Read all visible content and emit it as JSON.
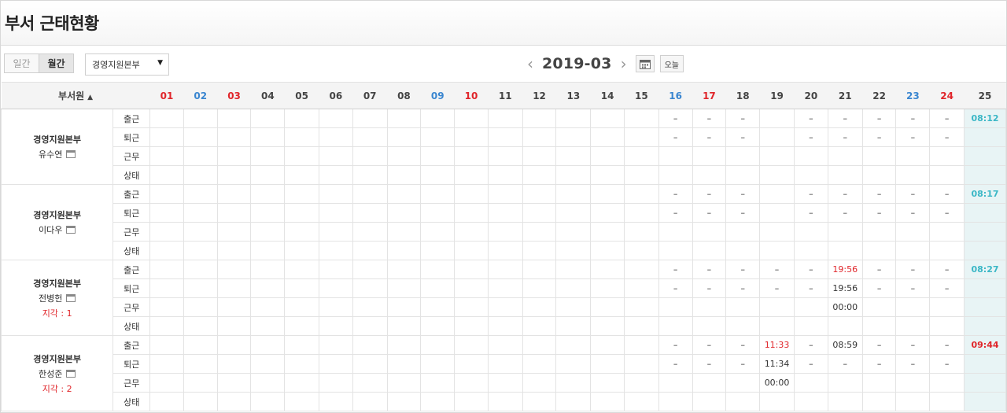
{
  "page": {
    "title": "부서 근태현황"
  },
  "toolbar": {
    "view_tabs": [
      {
        "label": "일간",
        "active": false
      },
      {
        "label": "월간",
        "active": true
      }
    ],
    "dept_select": {
      "value": "경영지원본부",
      "arrow": "▼"
    },
    "month": {
      "label": "2019-03",
      "prev_icon": "‹",
      "next_icon": "›"
    },
    "calendar_icon": "calendar-icon",
    "today_label": "오늘"
  },
  "colors": {
    "weekend_red": "#e0262b",
    "saturday_blue": "#3a86d0",
    "today_cyan": "#3bb7c6",
    "today_bg": "#e8f4f5",
    "late_red": "#e0262b"
  },
  "table": {
    "member_header": "부서원",
    "sort_icon": "▲",
    "days": [
      {
        "label": "01",
        "type": "sun"
      },
      {
        "label": "02",
        "type": "sat"
      },
      {
        "label": "03",
        "type": "sun"
      },
      {
        "label": "04",
        "type": "weekday"
      },
      {
        "label": "05",
        "type": "weekday"
      },
      {
        "label": "06",
        "type": "weekday"
      },
      {
        "label": "07",
        "type": "weekday"
      },
      {
        "label": "08",
        "type": "weekday"
      },
      {
        "label": "09",
        "type": "sat"
      },
      {
        "label": "10",
        "type": "sun"
      },
      {
        "label": "11",
        "type": "weekday"
      },
      {
        "label": "12",
        "type": "weekday"
      },
      {
        "label": "13",
        "type": "weekday"
      },
      {
        "label": "14",
        "type": "weekday"
      },
      {
        "label": "15",
        "type": "weekday"
      },
      {
        "label": "16",
        "type": "sat"
      },
      {
        "label": "17",
        "type": "sun"
      },
      {
        "label": "18",
        "type": "weekday"
      },
      {
        "label": "19",
        "type": "weekday"
      },
      {
        "label": "20",
        "type": "weekday"
      },
      {
        "label": "21",
        "type": "weekday"
      },
      {
        "label": "22",
        "type": "weekday"
      },
      {
        "label": "23",
        "type": "sat"
      },
      {
        "label": "24",
        "type": "sun"
      },
      {
        "label": "25",
        "type": "today"
      }
    ],
    "row_types": [
      "출근",
      "퇴근",
      "근무",
      "상태"
    ],
    "members": [
      {
        "dept": "경영지원본부",
        "name": "유수연",
        "late": "",
        "rows": [
          [
            "",
            "",
            "",
            "",
            "",
            "",
            "",
            "",
            "",
            "",
            "",
            "",
            "",
            "",
            "",
            "–",
            "–",
            "–",
            "",
            "–",
            "–",
            "–",
            "–",
            "–",
            {
              "v": "08:12",
              "c": "cyan"
            }
          ],
          [
            "",
            "",
            "",
            "",
            "",
            "",
            "",
            "",
            "",
            "",
            "",
            "",
            "",
            "",
            "",
            "–",
            "–",
            "–",
            "",
            "–",
            "–",
            "–",
            "–",
            "–",
            ""
          ],
          [
            "",
            "",
            "",
            "",
            "",
            "",
            "",
            "",
            "",
            "",
            "",
            "",
            "",
            "",
            "",
            "",
            "",
            "",
            "",
            "",
            "",
            "",
            "",
            "",
            ""
          ],
          [
            "",
            "",
            "",
            "",
            "",
            "",
            "",
            "",
            "",
            "",
            "",
            "",
            "",
            "",
            "",
            "",
            "",
            "",
            "",
            "",
            "",
            "",
            "",
            "",
            ""
          ]
        ]
      },
      {
        "dept": "경영지원본부",
        "name": "이다우",
        "late": "",
        "rows": [
          [
            "",
            "",
            "",
            "",
            "",
            "",
            "",
            "",
            "",
            "",
            "",
            "",
            "",
            "",
            "",
            "–",
            "–",
            "–",
            "",
            "–",
            "–",
            "–",
            "–",
            "–",
            {
              "v": "08:17",
              "c": "cyan"
            }
          ],
          [
            "",
            "",
            "",
            "",
            "",
            "",
            "",
            "",
            "",
            "",
            "",
            "",
            "",
            "",
            "",
            "–",
            "–",
            "–",
            "",
            "–",
            "–",
            "–",
            "–",
            "–",
            ""
          ],
          [
            "",
            "",
            "",
            "",
            "",
            "",
            "",
            "",
            "",
            "",
            "",
            "",
            "",
            "",
            "",
            "",
            "",
            "",
            "",
            "",
            "",
            "",
            "",
            "",
            ""
          ],
          [
            "",
            "",
            "",
            "",
            "",
            "",
            "",
            "",
            "",
            "",
            "",
            "",
            "",
            "",
            "",
            "",
            "",
            "",
            "",
            "",
            "",
            "",
            "",
            "",
            ""
          ]
        ]
      },
      {
        "dept": "경영지원본부",
        "name": "전병헌",
        "late": "지각 : 1",
        "rows": [
          [
            "",
            "",
            "",
            "",
            "",
            "",
            "",
            "",
            "",
            "",
            "",
            "",
            "",
            "",
            "",
            "–",
            "–",
            "–",
            "–",
            "–",
            {
              "v": "19:56",
              "c": "red"
            },
            "–",
            "–",
            "–",
            {
              "v": "08:27",
              "c": "cyan"
            }
          ],
          [
            "",
            "",
            "",
            "",
            "",
            "",
            "",
            "",
            "",
            "",
            "",
            "",
            "",
            "",
            "",
            "–",
            "–",
            "–",
            "–",
            "–",
            "19:56",
            "–",
            "–",
            "–",
            ""
          ],
          [
            "",
            "",
            "",
            "",
            "",
            "",
            "",
            "",
            "",
            "",
            "",
            "",
            "",
            "",
            "",
            "",
            "",
            "",
            "",
            "",
            "00:00",
            "",
            "",
            "",
            ""
          ],
          [
            "",
            "",
            "",
            "",
            "",
            "",
            "",
            "",
            "",
            "",
            "",
            "",
            "",
            "",
            "",
            "",
            "",
            "",
            "",
            "",
            "",
            "",
            "",
            "",
            ""
          ]
        ]
      },
      {
        "dept": "경영지원본부",
        "name": "한성준",
        "late": "지각 : 2",
        "rows": [
          [
            "",
            "",
            "",
            "",
            "",
            "",
            "",
            "",
            "",
            "",
            "",
            "",
            "",
            "",
            "",
            "–",
            "–",
            "–",
            {
              "v": "11:33",
              "c": "red"
            },
            "–",
            "08:59",
            "–",
            "–",
            "–",
            {
              "v": "09:44",
              "c": "redbold"
            }
          ],
          [
            "",
            "",
            "",
            "",
            "",
            "",
            "",
            "",
            "",
            "",
            "",
            "",
            "",
            "",
            "",
            "–",
            "–",
            "–",
            "11:34",
            "–",
            "–",
            "–",
            "–",
            "–",
            ""
          ],
          [
            "",
            "",
            "",
            "",
            "",
            "",
            "",
            "",
            "",
            "",
            "",
            "",
            "",
            "",
            "",
            "",
            "",
            "",
            "00:00",
            "",
            "",
            "",
            "",
            "",
            ""
          ],
          [
            "",
            "",
            "",
            "",
            "",
            "",
            "",
            "",
            "",
            "",
            "",
            "",
            "",
            "",
            "",
            "",
            "",
            "",
            "",
            "",
            "",
            "",
            "",
            "",
            ""
          ]
        ]
      }
    ]
  }
}
